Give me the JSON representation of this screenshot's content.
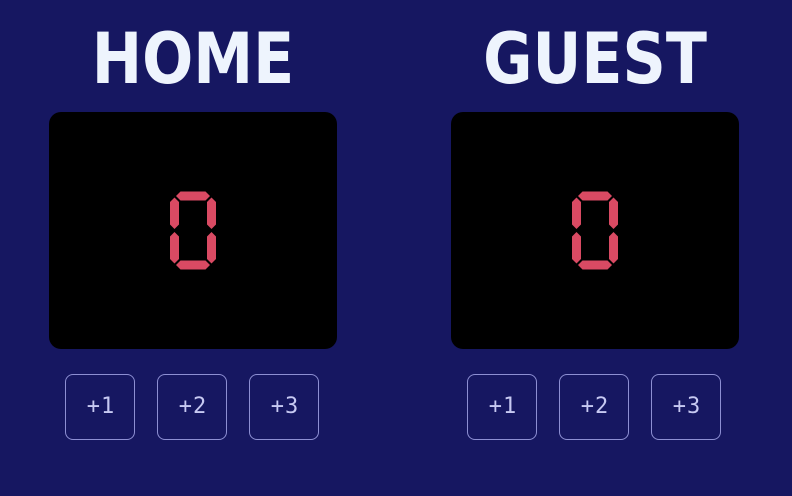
{
  "colors": {
    "background": "#161761",
    "title": "#eef4fd",
    "score_digit": "#d94a63",
    "score_panel": "#000000",
    "button_border": "#8d8fd3",
    "button_text": "#c7c9f2"
  },
  "home": {
    "title": "HOME",
    "score": "0",
    "buttons": [
      {
        "label": "+1"
      },
      {
        "label": "+2"
      },
      {
        "label": "+3"
      }
    ]
  },
  "guest": {
    "title": "GUEST",
    "score": "0",
    "buttons": [
      {
        "label": "+1"
      },
      {
        "label": "+2"
      },
      {
        "label": "+3"
      }
    ]
  }
}
